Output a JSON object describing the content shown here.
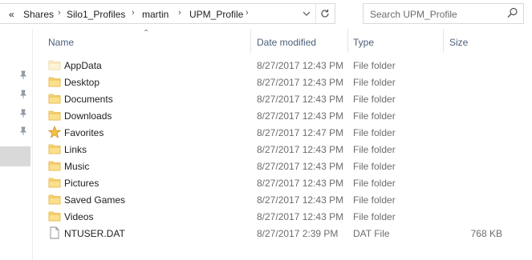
{
  "address": {
    "overflow": "«",
    "crumbs": [
      "Shares",
      "Silo1_Profiles",
      "martin",
      "UPM_Profile"
    ]
  },
  "search": {
    "placeholder": "Search UPM_Profile"
  },
  "columns": {
    "name": "Name",
    "date": "Date modified",
    "type": "Type",
    "size": "Size"
  },
  "files": [
    {
      "name": "AppData",
      "date": "8/27/2017 12:43 PM",
      "type": "File folder",
      "size": "",
      "icon": "folder-faded-icon"
    },
    {
      "name": "Desktop",
      "date": "8/27/2017 12:43 PM",
      "type": "File folder",
      "size": "",
      "icon": "folder-icon"
    },
    {
      "name": "Documents",
      "date": "8/27/2017 12:43 PM",
      "type": "File folder",
      "size": "",
      "icon": "folder-icon"
    },
    {
      "name": "Downloads",
      "date": "8/27/2017 12:43 PM",
      "type": "File folder",
      "size": "",
      "icon": "folder-icon"
    },
    {
      "name": "Favorites",
      "date": "8/27/2017 12:47 PM",
      "type": "File folder",
      "size": "",
      "icon": "star-icon"
    },
    {
      "name": "Links",
      "date": "8/27/2017 12:43 PM",
      "type": "File folder",
      "size": "",
      "icon": "folder-icon"
    },
    {
      "name": "Music",
      "date": "8/27/2017 12:43 PM",
      "type": "File folder",
      "size": "",
      "icon": "folder-icon"
    },
    {
      "name": "Pictures",
      "date": "8/27/2017 12:43 PM",
      "type": "File folder",
      "size": "",
      "icon": "folder-icon"
    },
    {
      "name": "Saved Games",
      "date": "8/27/2017 12:43 PM",
      "type": "File folder",
      "size": "",
      "icon": "folder-icon"
    },
    {
      "name": "Videos",
      "date": "8/27/2017 12:43 PM",
      "type": "File folder",
      "size": "",
      "icon": "folder-icon"
    },
    {
      "name": "NTUSER.DAT",
      "date": "8/27/2017 2:39 PM",
      "type": "DAT File",
      "size": "768 KB",
      "icon": "file-icon"
    }
  ],
  "colors": {
    "folder": "#f8d775",
    "folder_dark": "#e8b64a",
    "header_text": "#4c607a",
    "nav_selected": "#d9d9d9"
  }
}
